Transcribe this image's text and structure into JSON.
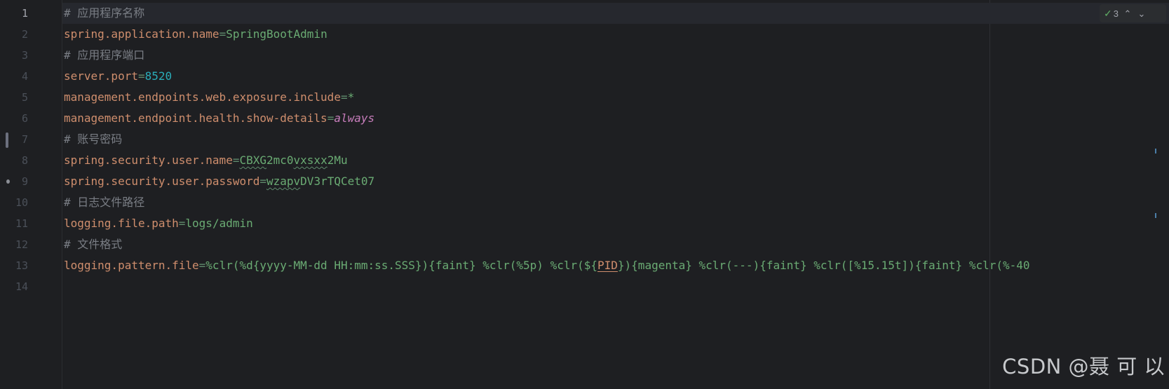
{
  "editor": {
    "current_line": 1,
    "lines": [
      {
        "number": "1",
        "tokens": [
          {
            "t": "comment",
            "text": "# 应用程序名称"
          }
        ]
      },
      {
        "number": "2",
        "tokens": [
          {
            "t": "key",
            "text": "spring.application.name"
          },
          {
            "t": "eq",
            "text": "="
          },
          {
            "t": "val",
            "text": "SpringBootAdmin"
          }
        ]
      },
      {
        "number": "3",
        "tokens": [
          {
            "t": "comment",
            "text": "# 应用程序端口"
          }
        ]
      },
      {
        "number": "4",
        "tokens": [
          {
            "t": "key",
            "text": "server.port"
          },
          {
            "t": "eq",
            "text": "="
          },
          {
            "t": "num",
            "text": "8520"
          }
        ]
      },
      {
        "number": "5",
        "tokens": [
          {
            "t": "key",
            "text": "management.endpoints.web.exposure.include"
          },
          {
            "t": "eq",
            "text": "="
          },
          {
            "t": "val",
            "text": "*"
          }
        ]
      },
      {
        "number": "6",
        "tokens": [
          {
            "t": "key",
            "text": "management.endpoint.health.show-details"
          },
          {
            "t": "eq",
            "text": "="
          },
          {
            "t": "kw",
            "text": "always"
          }
        ]
      },
      {
        "number": "7",
        "tokens": [
          {
            "t": "comment",
            "text": "# 账号密码"
          }
        ]
      },
      {
        "number": "8",
        "tokens": [
          {
            "t": "key",
            "text": "spring.security.user.name"
          },
          {
            "t": "eq",
            "text": "="
          },
          {
            "t": "val typo",
            "text": "CBXG"
          },
          {
            "t": "val",
            "text": "2mc0"
          },
          {
            "t": "val typo",
            "text": "vxsxx"
          },
          {
            "t": "val",
            "text": "2Mu"
          }
        ]
      },
      {
        "number": "9",
        "tokens": [
          {
            "t": "key",
            "text": "spring.security.user.password"
          },
          {
            "t": "eq",
            "text": "="
          },
          {
            "t": "val typo",
            "text": "wzapv"
          },
          {
            "t": "val",
            "text": "DV3rTQCet07"
          }
        ]
      },
      {
        "number": "10",
        "tokens": [
          {
            "t": "comment",
            "text": "# 日志文件路径"
          }
        ]
      },
      {
        "number": "11",
        "tokens": [
          {
            "t": "key",
            "text": "logging.file.path"
          },
          {
            "t": "eq",
            "text": "="
          },
          {
            "t": "val",
            "text": "logs/admin"
          }
        ]
      },
      {
        "number": "12",
        "tokens": [
          {
            "t": "comment",
            "text": "# 文件格式"
          }
        ]
      },
      {
        "number": "13",
        "tokens": [
          {
            "t": "key",
            "text": "logging.pattern.file"
          },
          {
            "t": "eq",
            "text": "="
          },
          {
            "t": "val",
            "text": "%clr(%d{yyyy-MM-dd HH:mm:ss.SSS}){faint} %clr(%5p) %clr(${"
          },
          {
            "t": "ref",
            "text": "PID"
          },
          {
            "t": "val",
            "text": "}){magenta} %clr(---){faint} %clr([%15.15t]){faint} %clr(%-40"
          }
        ]
      },
      {
        "number": "14",
        "tokens": []
      }
    ]
  },
  "inspection": {
    "icon": "check-icon",
    "count": "3",
    "prev_icon": "chevron-up-icon",
    "next_icon": "chevron-down-icon"
  },
  "watermark": {
    "text": "CSDN @聂 可 以"
  }
}
